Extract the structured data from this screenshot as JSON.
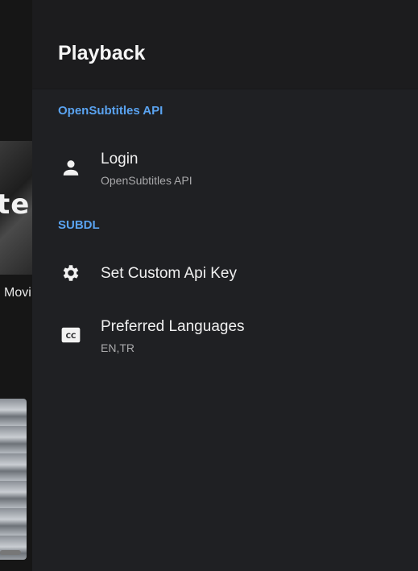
{
  "background": {
    "poster_text": "ter",
    "caption": "Movi"
  },
  "panel": {
    "title": "Playback",
    "sections": [
      {
        "label": "OpenSubtitles API",
        "items": [
          {
            "icon": "person-icon",
            "title": "Login",
            "subtitle": "OpenSubtitles API"
          }
        ]
      },
      {
        "label": "SUBDL",
        "items": [
          {
            "icon": "gear-icon",
            "title": "Set Custom Api Key"
          },
          {
            "icon": "closed-captions-icon",
            "title": "Preferred Languages",
            "subtitle": "EN,TR"
          }
        ]
      }
    ]
  },
  "colors": {
    "accent": "#5aa3f0",
    "panel_bg": "#1f2023",
    "header_bg": "#1c1c1e"
  }
}
